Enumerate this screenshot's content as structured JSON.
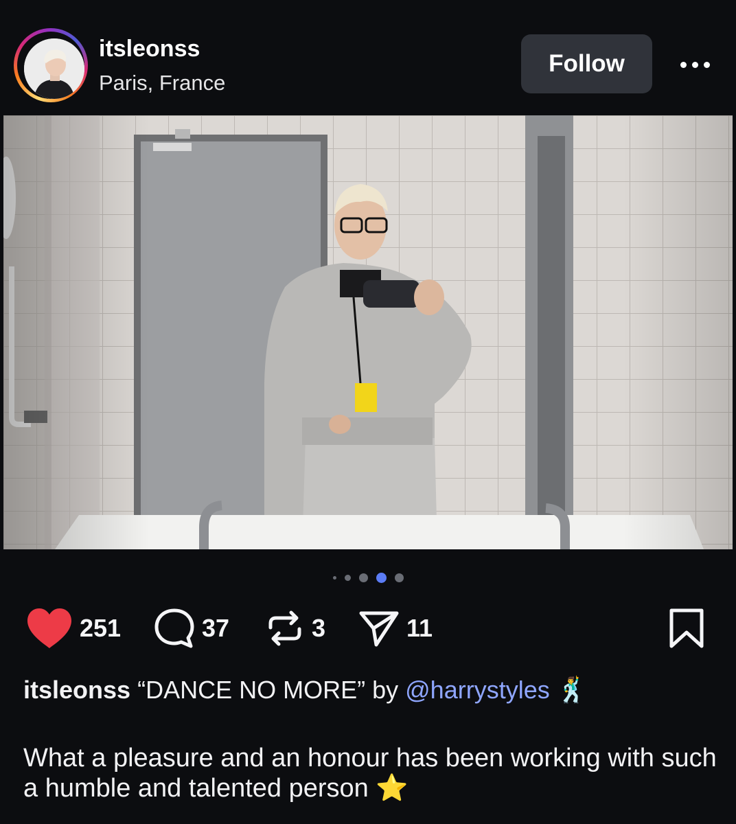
{
  "post": {
    "username": "itsleonss",
    "location": "Paris, France",
    "follow_label": "Follow"
  },
  "carousel": {
    "total": 5,
    "active_index": 3
  },
  "stats": {
    "likes": "251",
    "comments": "37",
    "reposts": "3",
    "shares": "11"
  },
  "caption": {
    "username": "itsleonss",
    "text": "“DANCE NO MORE” by",
    "mention": "@harrystyles",
    "emoji": "🕺",
    "body": "What a pleasure and an honour has been working with such a humble and talented person",
    "body_emoji": "⭐"
  },
  "colors": {
    "like": "#ed3b47",
    "mention": "#8fa6ff",
    "active_dot": "#5b7cf5",
    "follow_bg": "#30333a"
  }
}
